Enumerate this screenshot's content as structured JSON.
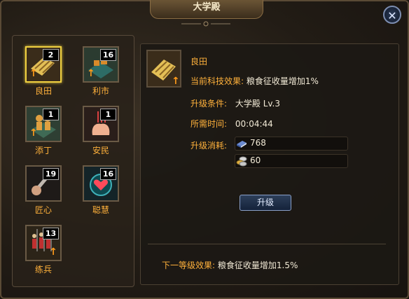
{
  "window": {
    "title": "大学殿"
  },
  "techs": [
    {
      "label": "良田",
      "count": "2",
      "icon": "farmland-icon",
      "selected": true,
      "upgradable": true
    },
    {
      "label": "利市",
      "count": "16",
      "icon": "market-icon",
      "selected": false,
      "upgradable": true
    },
    {
      "label": "添丁",
      "count": "1",
      "icon": "population-icon",
      "selected": false,
      "upgradable": true
    },
    {
      "label": "安民",
      "count": "1",
      "icon": "pacify-icon",
      "selected": false,
      "upgradable": false
    },
    {
      "label": "匠心",
      "count": "19",
      "icon": "craftsman-icon",
      "selected": false,
      "upgradable": false
    },
    {
      "label": "聪慧",
      "count": "16",
      "icon": "wisdom-icon",
      "selected": false,
      "upgradable": false
    },
    {
      "label": "练兵",
      "count": "13",
      "icon": "drill-troops-icon",
      "selected": false,
      "upgradable": true
    }
  ],
  "detail": {
    "name": "良田",
    "effect_label": "当前科技效果:",
    "effect_value": "粮食征收量增加1%",
    "condition_label": "升级条件:",
    "condition_value": "大学殿 Lv.3",
    "time_label": "所需时间:",
    "time_value": "00:04:44",
    "cost_label": "升级消耗:",
    "cost_books": "768",
    "cost_silver": "60",
    "upgrade_button": "升级",
    "next_label": "下一等级效果:",
    "next_value": "粮食征收量增加1.5%"
  },
  "colors": {
    "label": "#ffb13b",
    "value": "#f2ead6",
    "selected_border": "#f0d040",
    "arrow": "#ff9b1a"
  }
}
